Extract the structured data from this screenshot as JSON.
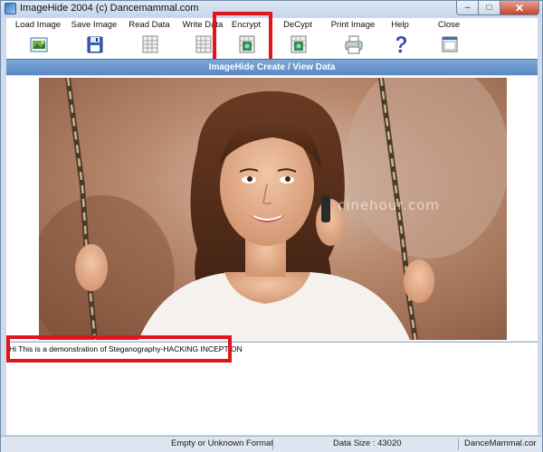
{
  "window": {
    "title": "ImageHide 2004 (c) Dancemammal.com",
    "controls": {
      "minimize": "‒",
      "maximize": "□",
      "close": "✕"
    }
  },
  "toolbar": {
    "items": [
      {
        "label": "Load Image",
        "icon": "load-image-icon"
      },
      {
        "label": "Save Image",
        "icon": "floppy-disk-icon"
      },
      {
        "label": "Read Data",
        "icon": "grid-document-icon"
      },
      {
        "label": "Write Data",
        "icon": "grid-document-icon"
      },
      {
        "label": "Encrypt",
        "icon": "encrypt-icon",
        "highlighted": true
      },
      {
        "label": "DeCypt",
        "icon": "decrypt-icon"
      },
      {
        "label": "Print Image",
        "icon": "printer-icon"
      },
      {
        "label": "Help",
        "icon": "question-mark-icon"
      },
      {
        "label": "Close",
        "icon": "close-window-icon"
      }
    ]
  },
  "header": {
    "title": "ImageHide Create / View Data"
  },
  "image": {
    "watermark": "cinehour.com"
  },
  "message": {
    "text": "Hi This is a demonstration of Steganography-HACKING INCEPTION"
  },
  "status": {
    "format": "Empty or Unknown Format",
    "data_size": "Data Size : 43020",
    "brand": "DanceMammal.cor"
  },
  "colors": {
    "highlight": "#e0141b",
    "header": "#6a95cf",
    "frame": "#cfdbea"
  }
}
